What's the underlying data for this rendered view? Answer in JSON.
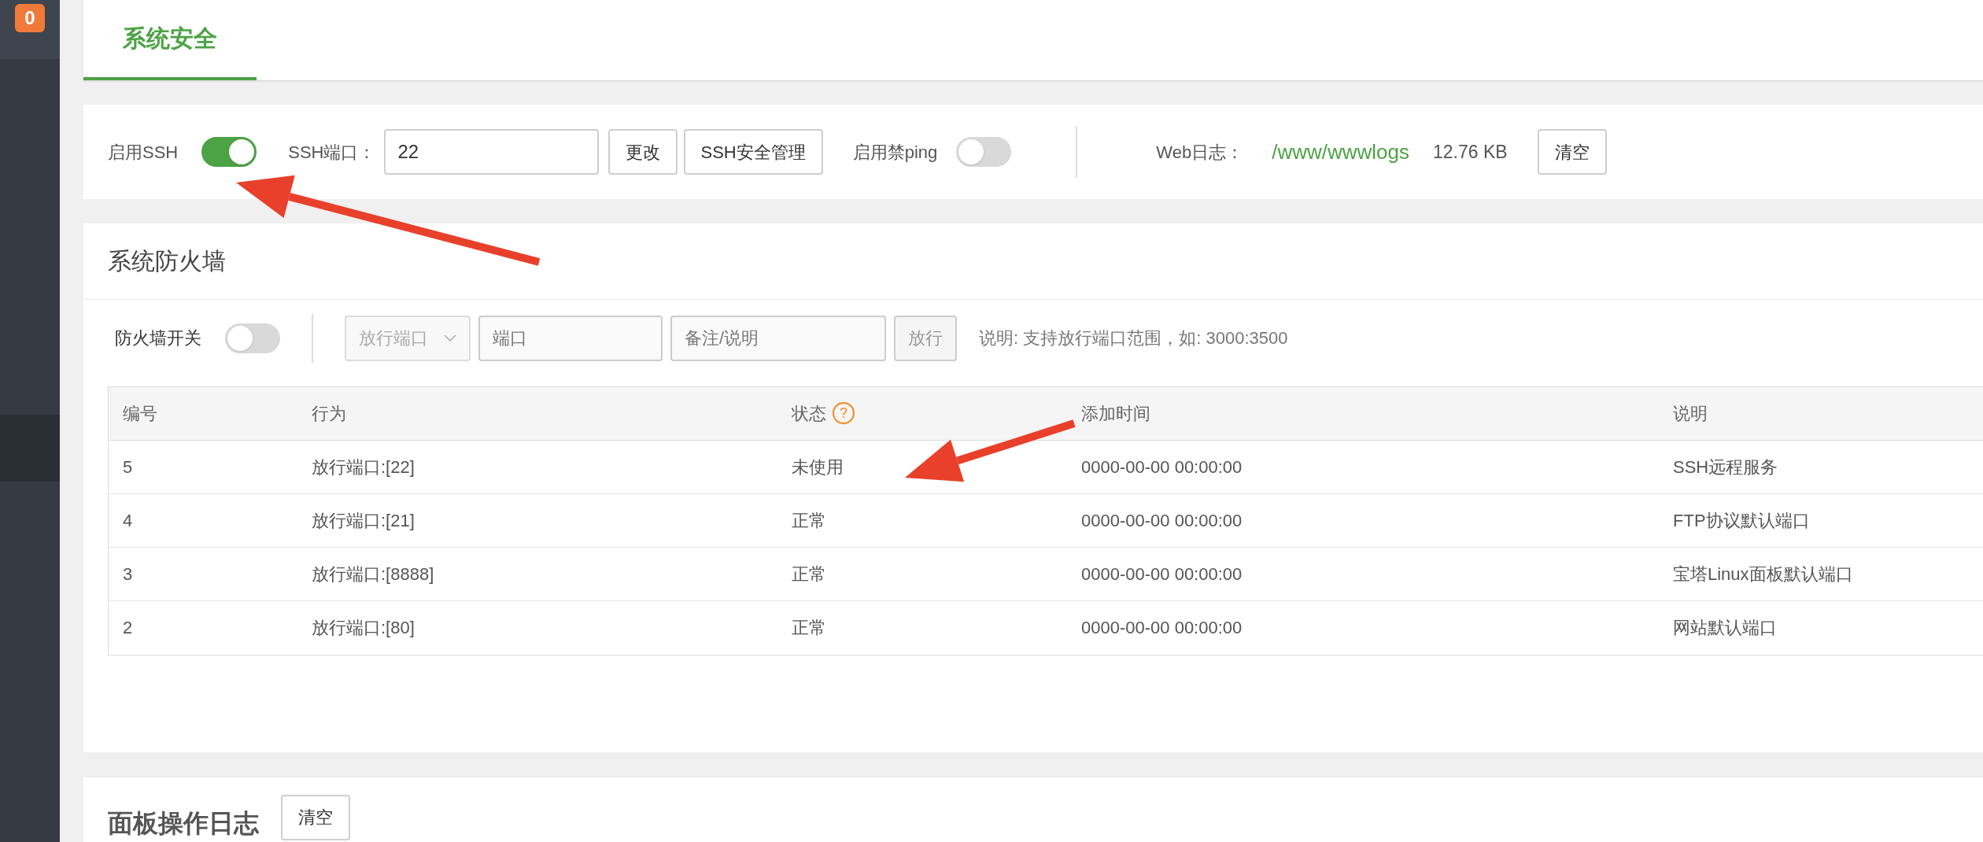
{
  "sidebar": {
    "badge": "0"
  },
  "tabs": [
    {
      "label": "系统安全",
      "selected": true
    }
  ],
  "ssh": {
    "label": "启用SSH",
    "on": true,
    "port_label": "SSH端口：",
    "port_value": "22",
    "change_button": "更改",
    "manage_button": "SSH安全管理",
    "ping_label": "启用禁ping",
    "ping_on": false,
    "web_log_label": "Web日志：",
    "web_log_path": "/www/wwwlogs",
    "web_log_size": "12.76 KB",
    "clear_button": "清空"
  },
  "firewall": {
    "title": "系统防火墙",
    "switch_label": "防火墙开关",
    "on": false,
    "select_value": "放行端口",
    "port_placeholder": "端口",
    "note_placeholder": "备注/说明",
    "allow_button": "放行",
    "hint": "说明: 支持放行端口范围，如: 3000:3500",
    "table": {
      "columns": [
        "编号",
        "行为",
        "状态",
        "添加时间",
        "说明"
      ],
      "help_mark": "?",
      "rows": [
        {
          "cells": [
            "5",
            "放行端口:[22]",
            "未使用",
            "0000-00-00 00:00:00",
            "SSH远程服务"
          ]
        },
        {
          "cells": [
            "4",
            "放行端口:[21]",
            "正常",
            "0000-00-00 00:00:00",
            "FTP协议默认端口"
          ]
        },
        {
          "cells": [
            "3",
            "放行端口:[8888]",
            "正常",
            "0000-00-00 00:00:00",
            "宝塔Linux面板默认端口"
          ]
        },
        {
          "cells": [
            "2",
            "放行端口:[80]",
            "正常",
            "0000-00-00 00:00:00",
            "网站默认端口"
          ]
        }
      ]
    }
  },
  "panel_log": {
    "title": "面板操作日志",
    "clear_button": "清空"
  }
}
